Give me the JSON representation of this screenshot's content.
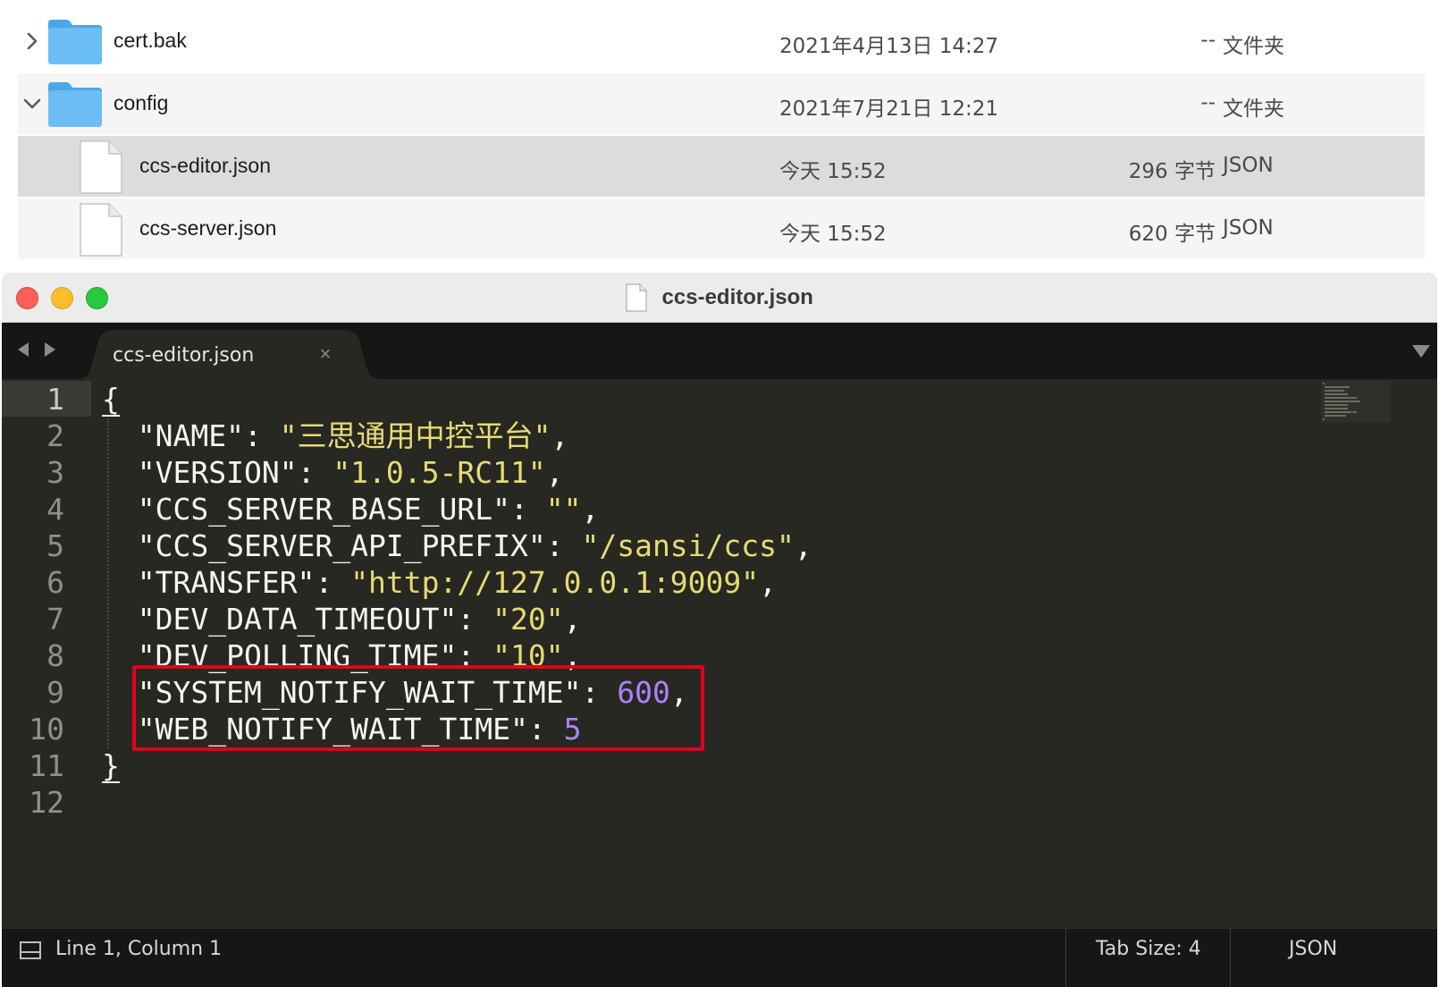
{
  "finder": {
    "rows": [
      {
        "name": "cert.bak",
        "date": "2021年4月13日 14:27",
        "size": "--",
        "kind": "文件夹",
        "type": "folder",
        "expanded": false
      },
      {
        "name": "config",
        "date": "2021年7月21日 12:21",
        "size": "--",
        "kind": "文件夹",
        "type": "folder",
        "expanded": true
      },
      {
        "name": "ccs-editor.json",
        "date": "今天 15:52",
        "size": "296 字节",
        "kind": "JSON",
        "type": "file",
        "selected": true
      },
      {
        "name": "ccs-server.json",
        "date": "今天 15:52",
        "size": "620 字节",
        "kind": "JSON",
        "type": "file"
      }
    ]
  },
  "editor": {
    "window_title": "ccs-editor.json",
    "tab_label": "ccs-editor.json",
    "tab_close_glyph": "×",
    "line_numbers": [
      "1",
      "2",
      "3",
      "4",
      "5",
      "6",
      "7",
      "8",
      "9",
      "10",
      "11",
      "12"
    ],
    "lines": [
      {
        "open": "{"
      },
      {
        "key": "\"NAME\"",
        "value": "\"三思通用中控平台\"",
        "value_type": "string",
        "trail": ","
      },
      {
        "key": "\"VERSION\"",
        "value": "\"1.0.5-RC11\"",
        "value_type": "string",
        "trail": ","
      },
      {
        "key": "\"CCS_SERVER_BASE_URL\"",
        "value": "\"\"",
        "value_type": "string",
        "trail": ","
      },
      {
        "key": "\"CCS_SERVER_API_PREFIX\"",
        "value": "\"/sansi/ccs\"",
        "value_type": "string",
        "trail": ","
      },
      {
        "key": "\"TRANSFER\"",
        "value": "\"http://127.0.0.1:9009\"",
        "value_type": "string",
        "trail": ","
      },
      {
        "key": "\"DEV_DATA_TIMEOUT\"",
        "value": "\"20\"",
        "value_type": "string",
        "trail": ","
      },
      {
        "key": "\"DEV_POLLING_TIME\"",
        "value": "\"10\"",
        "value_type": "string",
        "trail": ","
      },
      {
        "key": "\"SYSTEM_NOTIFY_WAIT_TIME\"",
        "value": "600",
        "value_type": "number",
        "trail": ","
      },
      {
        "key": "\"WEB_NOTIFY_WAIT_TIME\"",
        "value": "5",
        "value_type": "number",
        "trail": ""
      },
      {
        "close": "}"
      },
      {
        "empty": ""
      }
    ],
    "status": {
      "cursor": "Line 1, Column 1",
      "tab_size": "Tab Size: 4",
      "syntax": "JSON"
    },
    "colors": {
      "background": "#272822",
      "string": "#e6db74",
      "number": "#ae81ff",
      "text": "#f8f8f2",
      "highlight": "#e0001b"
    }
  }
}
